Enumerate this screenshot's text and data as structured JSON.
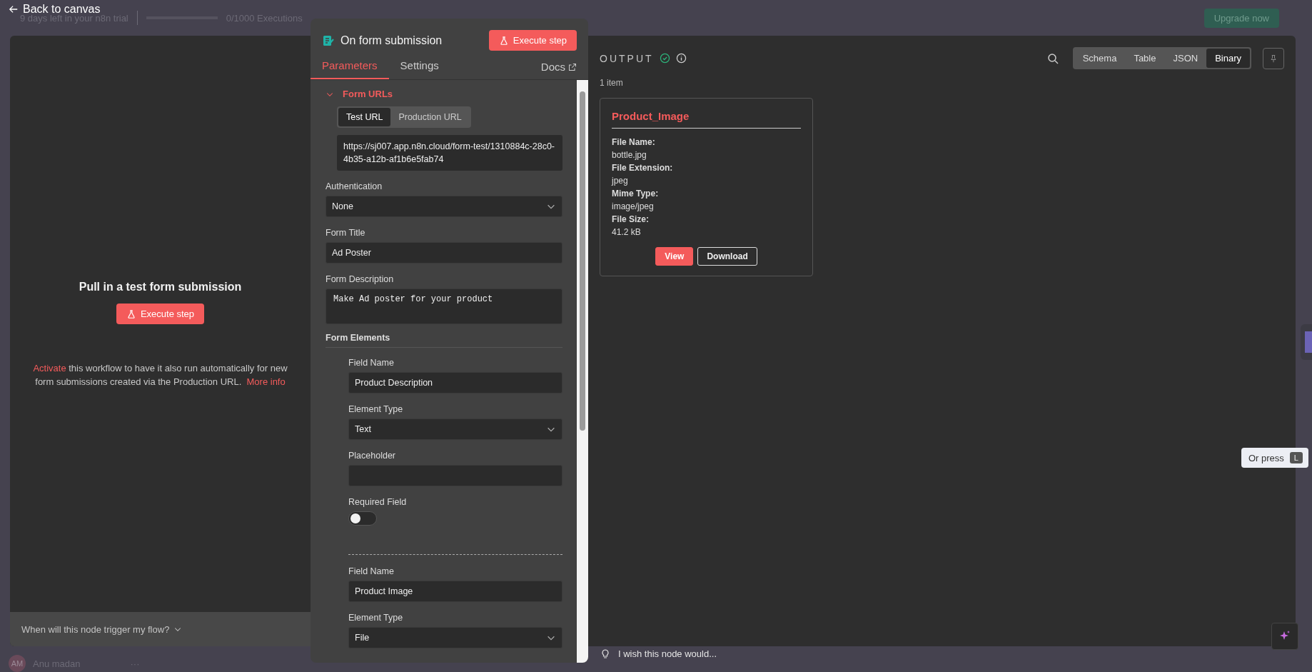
{
  "header": {
    "back_label": "Back to canvas",
    "trial_text": "9 days left in your n8n trial",
    "executions": "0/1000 Executions",
    "upgrade_button": "Upgrade now"
  },
  "user": {
    "initials": "AM",
    "name": "Anu madan",
    "more": "···"
  },
  "input_panel": {
    "title": "Pull in a test form submission",
    "execute_button": "Execute step",
    "note_link": "Activate",
    "note_text": "this workflow to have it also run automatically for new form submissions created via the Production URL.",
    "more_link": "More info",
    "footer": "When will this node trigger my flow?"
  },
  "node_panel": {
    "title": "On form submission",
    "execute_button": "Execute step",
    "tabs": [
      {
        "label": "Parameters",
        "selected": true
      },
      {
        "label": "Settings",
        "selected": false
      }
    ],
    "docs_link": "Docs",
    "parameters": [
      {
        "kind": "url_group",
        "label": "Form URLs",
        "expanded": true,
        "tabs": [
          {
            "label": "Test URL",
            "selected": true
          },
          {
            "label": "Production URL",
            "selected": false
          }
        ],
        "url": "https://sj007.app.n8n.cloud/form-test/1310884c-28c0-4b35-a12b-af1b6e5fab74"
      },
      {
        "kind": "select",
        "label": "Authentication",
        "value": "None"
      },
      {
        "kind": "input",
        "label": "Form Title",
        "value": "Ad Poster"
      },
      {
        "kind": "textarea",
        "label": "Form Description",
        "value": "Make Ad poster for your product"
      },
      {
        "kind": "collection",
        "label": "Form Elements",
        "items": [
          {
            "fields": [
              {
                "kind": "input",
                "label": "Field Name",
                "value": "Product Description"
              },
              {
                "kind": "select",
                "label": "Element Type",
                "value": "Text"
              },
              {
                "kind": "input",
                "label": "Placeholder"
              },
              {
                "kind": "toggle",
                "label": "Required Field",
                "on": false
              }
            ]
          },
          {
            "fields": [
              {
                "kind": "input",
                "label": "Field Name",
                "value": "Product Image"
              },
              {
                "kind": "select",
                "label": "Element Type",
                "value": "File"
              }
            ]
          }
        ]
      }
    ]
  },
  "output_panel": {
    "title": "OUTPUT",
    "count": "1 item",
    "views": [
      {
        "label": "Schema",
        "selected": false
      },
      {
        "label": "Table",
        "selected": false
      },
      {
        "label": "JSON",
        "selected": false
      },
      {
        "label": "Binary",
        "selected": true
      }
    ],
    "binary_card": {
      "title": "Product_Image",
      "fields": [
        {
          "label": "File Name:",
          "value": "bottle.jpg"
        },
        {
          "label": "File Extension:",
          "value": "jpeg"
        },
        {
          "label": "Mime Type:",
          "value": "image/jpeg"
        },
        {
          "label": "File Size:",
          "value": "41.2 kB"
        }
      ],
      "buttons": [
        {
          "label": "View",
          "kind": "primary"
        },
        {
          "label": "Download",
          "kind": "secondary"
        }
      ]
    }
  },
  "feedback": "I wish this node would...",
  "tooltip": {
    "text": "Or press",
    "key": "L"
  }
}
